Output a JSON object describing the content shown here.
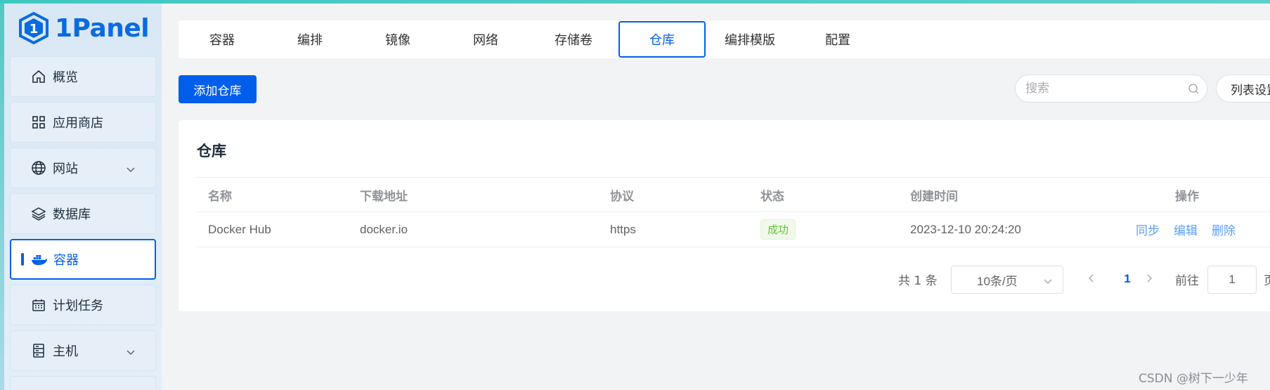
{
  "app": {
    "name": "1Panel"
  },
  "sidebar": {
    "items": [
      {
        "label": "概览",
        "icon": "home-icon"
      },
      {
        "label": "应用商店",
        "icon": "grid-icon"
      },
      {
        "label": "网站",
        "icon": "globe-icon",
        "expandable": true
      },
      {
        "label": "数据库",
        "icon": "layers-icon"
      },
      {
        "label": "容器",
        "icon": "docker-icon",
        "active": true
      },
      {
        "label": "计划任务",
        "icon": "calendar-icon"
      },
      {
        "label": "主机",
        "icon": "server-icon",
        "expandable": true
      }
    ]
  },
  "tabs": [
    {
      "label": "容器"
    },
    {
      "label": "编排"
    },
    {
      "label": "镜像"
    },
    {
      "label": "网络"
    },
    {
      "label": "存储卷"
    },
    {
      "label": "仓库",
      "active": true
    },
    {
      "label": "编排模版"
    },
    {
      "label": "配置"
    }
  ],
  "toolbar": {
    "add_label": "添加仓库",
    "search_placeholder": "搜索",
    "column_settings_label": "列表设置"
  },
  "card": {
    "title": "仓库",
    "columns": [
      "名称",
      "下载地址",
      "协议",
      "状态",
      "创建时间",
      "操作"
    ],
    "rows": [
      {
        "name": "Docker Hub",
        "url": "docker.io",
        "protocol": "https",
        "status": "成功",
        "created": "2023-12-10 20:24:20",
        "actions": [
          "同步",
          "编辑",
          "删除"
        ]
      }
    ]
  },
  "pagination": {
    "total_label": "共 1 条",
    "page_size": "10条/页",
    "current_page": "1",
    "goto_label": "前往",
    "goto_value": "1",
    "page_suffix": "页"
  },
  "colors": {
    "accent": "#005eeb",
    "success": "#67c23a",
    "link": "#589ef8"
  },
  "watermark": "CSDN @树下一少年"
}
